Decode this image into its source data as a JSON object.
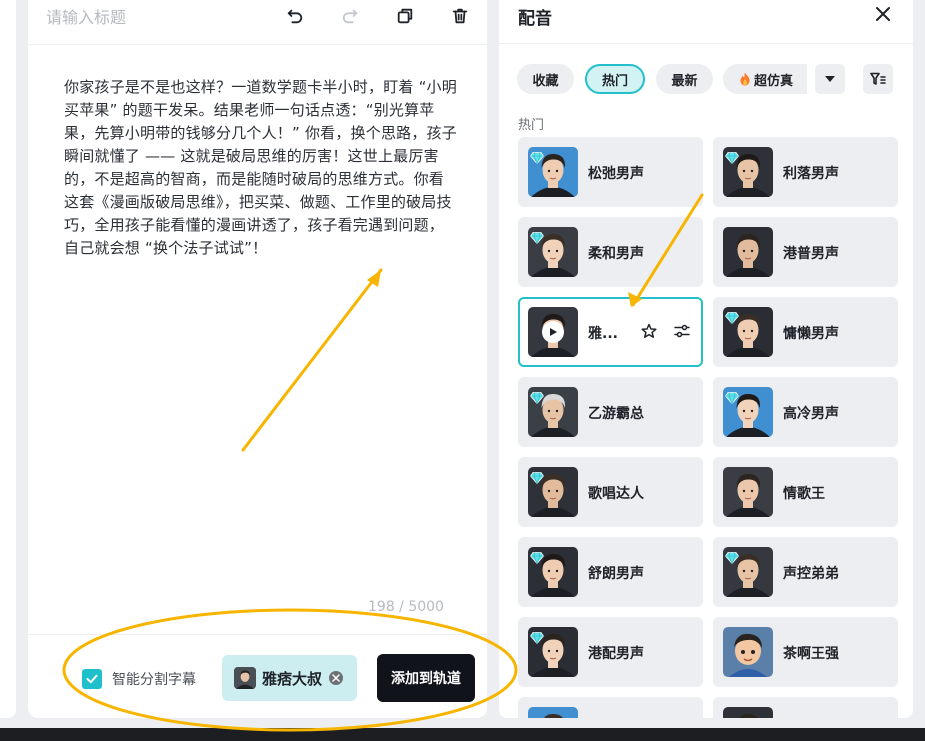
{
  "editor": {
    "title_placeholder": "请输入标题",
    "script_text": "你家孩子是不是也这样？一道数学题卡半小时，盯着 “小明买苹果” 的题干发呆。结果老师一句话点透：“别光算苹果，先算小明带的钱够分几个人！” 你看，换个思路，孩子瞬间就懂了 —— 这就是破局思维的厉害！这世上最厉害的，不是超高的智商，而是能随时破局的思维方式。你看这套《漫画版破局思维》，把买菜、做题、工作里的破局技巧，全用孩子能看懂的漫画讲透了，孩子看完遇到问题，自己就会想 “换个法子试试”！",
    "char_count": "198 / 5000",
    "smart_subtitle_label": "智能分割字幕",
    "smart_subtitle_checked": true,
    "selected_voice_name": "雅痞大叔",
    "add_to_track_label": "添加到轨道"
  },
  "panel": {
    "title": "配音",
    "tabs": [
      {
        "label": "收藏",
        "active": false
      },
      {
        "label": "热门",
        "active": true
      },
      {
        "label": "最新",
        "active": false
      },
      {
        "label": "超仿真",
        "active": false
      }
    ],
    "section_label": "热门",
    "voices": [
      {
        "name": "松弛男声",
        "premium": true
      },
      {
        "name": "利落男声",
        "premium": true
      },
      {
        "name": "柔和男声",
        "premium": true
      },
      {
        "name": "港普男声",
        "premium": false
      },
      {
        "name": "雅...",
        "premium": false,
        "selected": true
      },
      {
        "name": "慵懒男声",
        "premium": true
      },
      {
        "name": "乙游霸总",
        "premium": true
      },
      {
        "name": "高冷男声",
        "premium": true
      },
      {
        "name": "歌唱达人",
        "premium": true
      },
      {
        "name": "情歌王",
        "premium": false
      },
      {
        "name": "舒朗男声",
        "premium": true
      },
      {
        "name": "声控弟弟",
        "premium": true
      },
      {
        "name": "港配男声",
        "premium": true
      },
      {
        "name": "茶啊王强",
        "premium": false
      }
    ]
  },
  "colors": {
    "accent": "#23c0cc",
    "annotation": "#f7b500",
    "dark_button": "#10131a"
  }
}
